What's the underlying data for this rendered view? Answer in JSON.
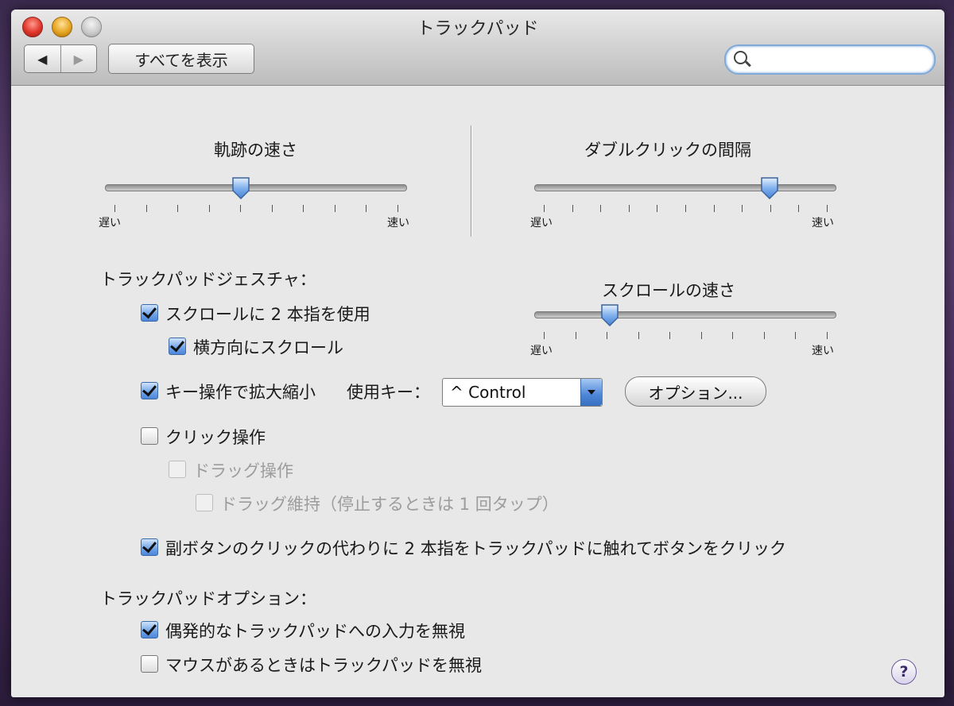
{
  "window": {
    "title": "トラックパッド"
  },
  "toolbar": {
    "back_glyph": "◀",
    "forward_glyph": "▶",
    "show_all_label": "すべてを表示",
    "search_value": ""
  },
  "tracking": {
    "label": "軌跡の速さ",
    "min_label": "遅い",
    "max_label": "速い",
    "value": 0.45,
    "ticks": 10
  },
  "double_click": {
    "label": "ダブルクリックの間隔",
    "min_label": "遅い",
    "max_label": "速い",
    "value": 0.78,
    "ticks": 11
  },
  "scroll_speed": {
    "label": "スクロールの速さ",
    "min_label": "遅い",
    "max_label": "速い",
    "value": 0.25,
    "ticks": 10
  },
  "gestures": {
    "heading": "トラックパッドジェスチャ：",
    "two_finger_scroll": {
      "label": "スクロールに 2 本指を使用",
      "checked": true
    },
    "horizontal_scroll": {
      "label": "横方向にスクロール",
      "checked": true
    },
    "zoom": {
      "label": "キー操作で拡大縮小",
      "checked": true
    },
    "modifier_label": "使用キー：",
    "modifier_value": "^ Control",
    "options_label": "オプション...",
    "clicking": {
      "label": "クリック操作",
      "checked": false
    },
    "dragging": {
      "label": "ドラッグ操作",
      "checked": false,
      "enabled": false
    },
    "drag_lock": {
      "label": "ドラッグ維持（停止するときは 1 回タップ）",
      "checked": false,
      "enabled": false
    },
    "secondary_click": {
      "label": "副ボタンのクリックの代わりに 2 本指をトラックパッドに触れてボタンをクリック",
      "checked": true
    }
  },
  "options": {
    "heading": "トラックパッドオプション：",
    "ignore_accidental": {
      "label": "偶発的なトラックパッドへの入力を無視",
      "checked": true
    },
    "ignore_with_mouse": {
      "label": "マウスがあるときはトラックパッドを無視",
      "checked": false
    }
  },
  "help_label": "?"
}
